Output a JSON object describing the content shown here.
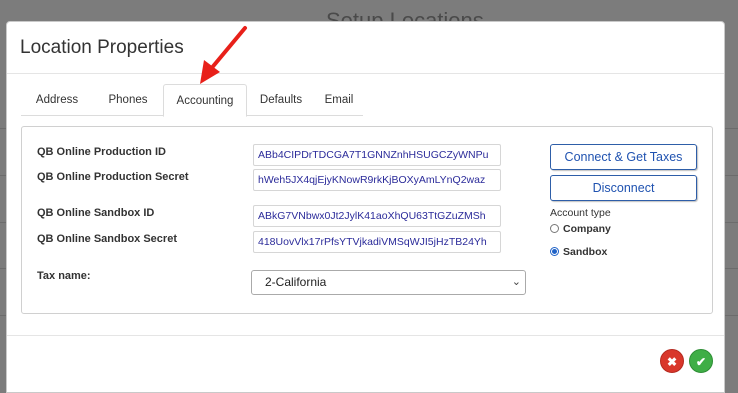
{
  "background": {
    "title": "Setup Locations"
  },
  "modal": {
    "title": "Location Properties"
  },
  "tabs": [
    {
      "label": "Address"
    },
    {
      "label": "Phones"
    },
    {
      "label": "Accounting"
    },
    {
      "label": "Defaults"
    },
    {
      "label": "Email"
    }
  ],
  "active_tab": "Accounting",
  "fields": {
    "qb_prod_id": {
      "label": "QB Online Production ID",
      "value": "ABb4CIPDrTDCGA7T1GNNZnhHSUGCZyWNPu"
    },
    "qb_prod_secret": {
      "label": "QB Online Production Secret",
      "value": "hWeh5JX4qjEjyKNowR9rkKjBOXyAmLYnQ2waz"
    },
    "qb_sandbox_id": {
      "label": "QB Online Sandbox ID",
      "value": "ABkG7VNbwx0Jt2JylK41aoXhQU63TtGZuZMSh"
    },
    "qb_sandbox_secret": {
      "label": "QB Online Sandbox Secret",
      "value": "418UovVlx17rPfsYTVjkadiVMSqWJI5jHzTB24Yh"
    },
    "tax_name": {
      "label": "Tax name:",
      "value": "2-California"
    }
  },
  "buttons": {
    "connect": "Connect & Get Taxes",
    "disconnect": "Disconnect"
  },
  "account_type": {
    "label": "Account type",
    "options": [
      {
        "label": "Company",
        "selected": false
      },
      {
        "label": "Sandbox",
        "selected": true
      }
    ]
  },
  "footer": {
    "cancel_symbol": "✖",
    "ok_symbol": "✔"
  },
  "colors": {
    "primary": "#1f52b0",
    "cancel": "#d9372b",
    "ok": "#3fae46",
    "annotation_arrow": "#e8201a"
  }
}
